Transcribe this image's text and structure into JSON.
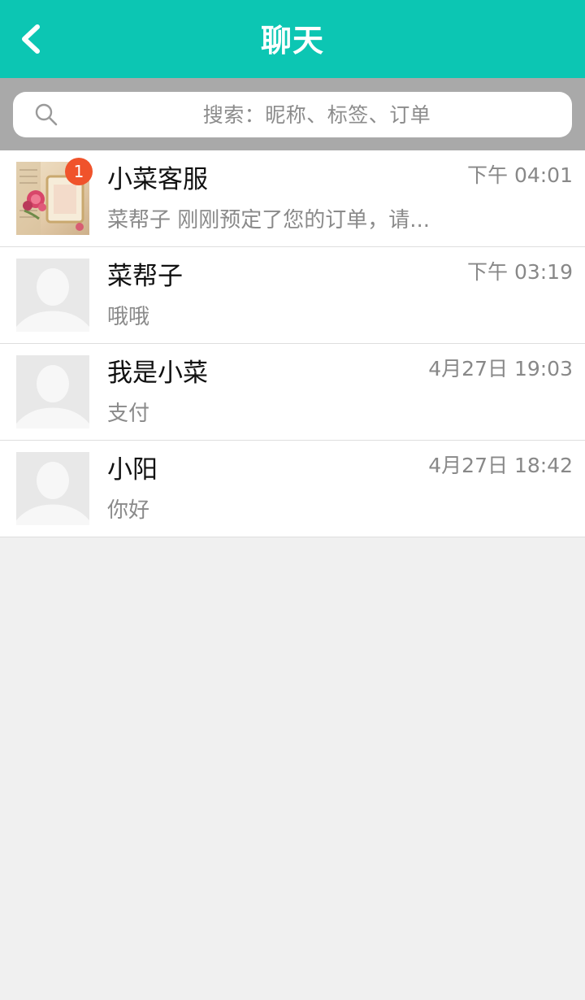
{
  "header": {
    "title": "聊天",
    "back_icon": "chevron-left-icon"
  },
  "search": {
    "placeholder": "搜索：昵称、标签、订单",
    "icon": "search-icon"
  },
  "chats": [
    {
      "name": "小菜客服",
      "time": "下午 04:01",
      "preview": "菜帮子 刚刚预定了您的订单，请...",
      "unread": "1",
      "avatar": "photo-avatar"
    },
    {
      "name": "菜帮子",
      "time": "下午 03:19",
      "preview": "哦哦",
      "avatar": "default-avatar"
    },
    {
      "name": "我是小菜",
      "time": "4月27日 19:03",
      "preview": "支付",
      "avatar": "default-avatar"
    },
    {
      "name": "小阳",
      "time": "4月27日 18:42",
      "preview": "你好",
      "avatar": "default-avatar"
    }
  ],
  "colors": {
    "header_bg": "#0cc6b3",
    "badge_bg": "#f0532b",
    "search_bar_bg": "#a9a9a9",
    "page_bg": "#f0f0f0"
  }
}
